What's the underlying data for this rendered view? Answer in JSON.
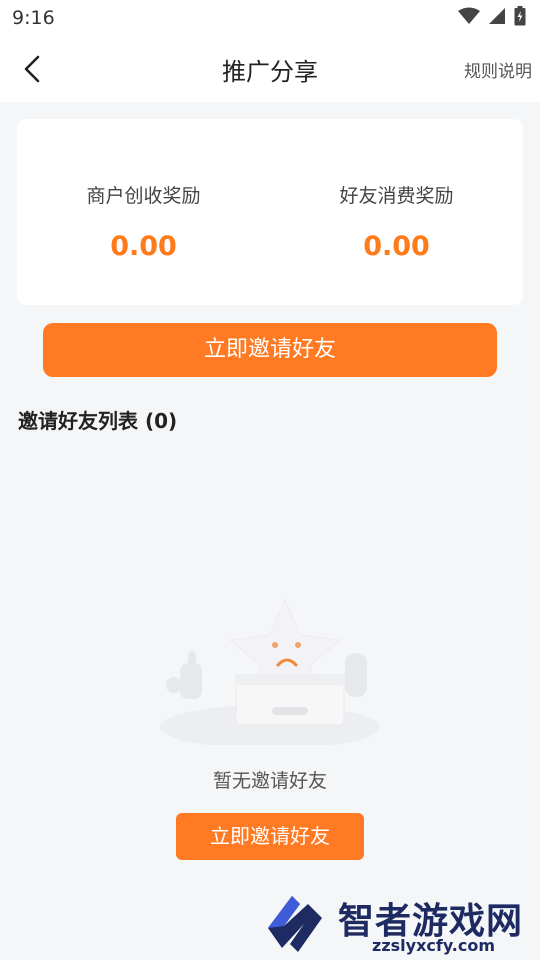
{
  "status_bar": {
    "time": "9:16",
    "icons": [
      "wifi-icon",
      "signal-icon",
      "battery-icon"
    ]
  },
  "header": {
    "title": "推广分享",
    "rules_link": "规则说明",
    "back_icon": "chevron-left-icon"
  },
  "rewards": {
    "merchant_label": "商户创收奖励",
    "merchant_value": "0.00",
    "friend_label": "好友消费奖励",
    "friend_value": "0.00"
  },
  "invite_button_label": "立即邀请好友",
  "invite_list": {
    "title": "邀请好友列表 (0)"
  },
  "empty_state": {
    "message": "暂无邀请好友",
    "button_label": "立即邀请好友"
  },
  "watermark": {
    "brand": "智者游戏网",
    "url": "zzslyxcfy.com"
  },
  "colors": {
    "accent": "#ff7a22",
    "reward_value": "#ff7a1a",
    "background": "#f5f6f8",
    "card": "#ffffff"
  }
}
